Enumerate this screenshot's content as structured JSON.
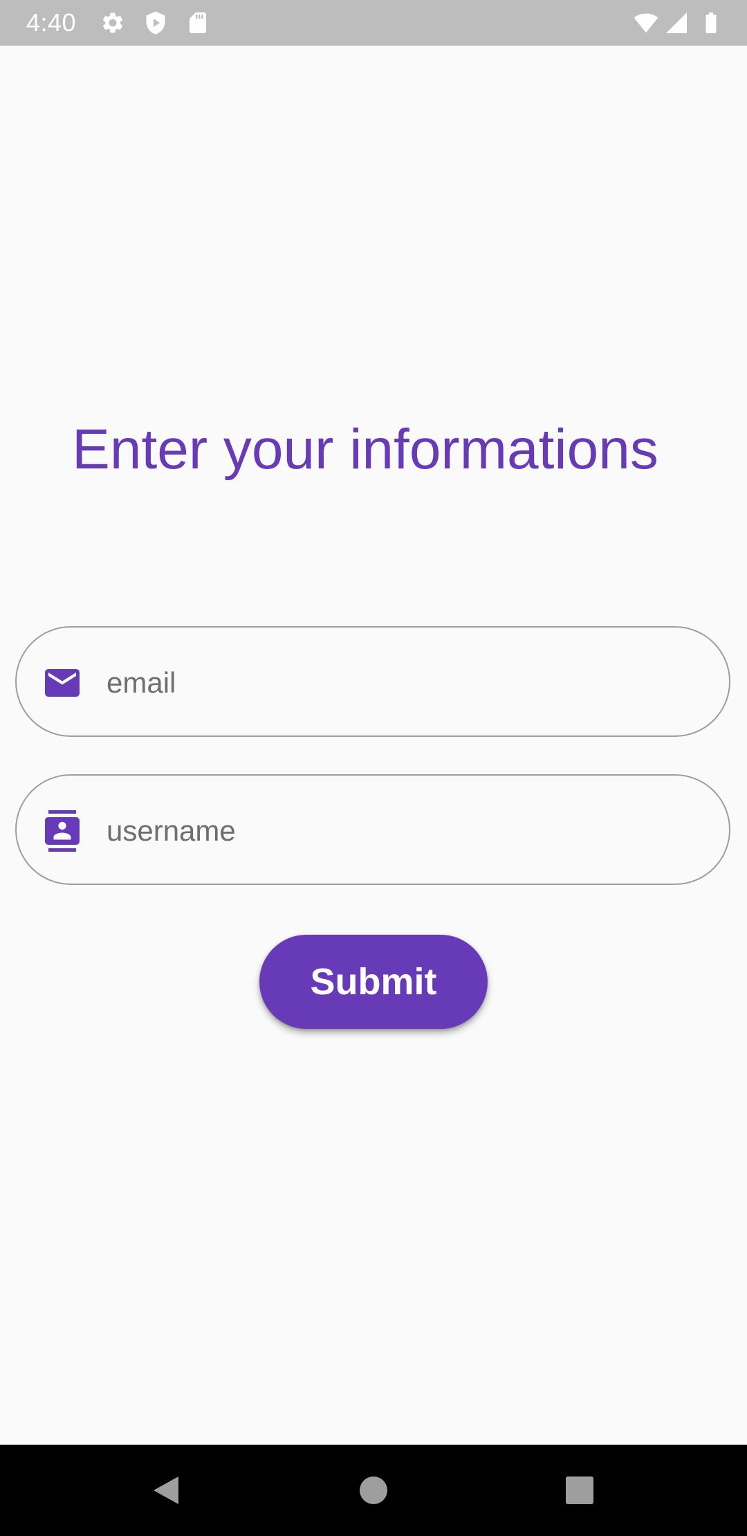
{
  "status_bar": {
    "time": "4:40",
    "icons_left": [
      "gear-icon",
      "shield-play-icon",
      "sd-card-icon"
    ],
    "icons_right": [
      "wifi-icon",
      "cell-signal-icon",
      "battery-icon"
    ]
  },
  "page": {
    "title": "Enter your informations"
  },
  "form": {
    "email": {
      "icon": "mail-icon",
      "placeholder": "email",
      "value": ""
    },
    "username": {
      "icon": "contact-icon",
      "placeholder": "username",
      "value": ""
    },
    "submit_label": "Submit"
  },
  "nav_bar": {
    "buttons": [
      "back-icon",
      "home-icon",
      "recents-icon"
    ]
  },
  "colors": {
    "accent": "#673ab7",
    "background": "#fafafa",
    "status_bar": "#bdbdbd",
    "field_border": "#9e9e9e",
    "placeholder": "#6e6e6e",
    "nav_bar": "#000000"
  }
}
